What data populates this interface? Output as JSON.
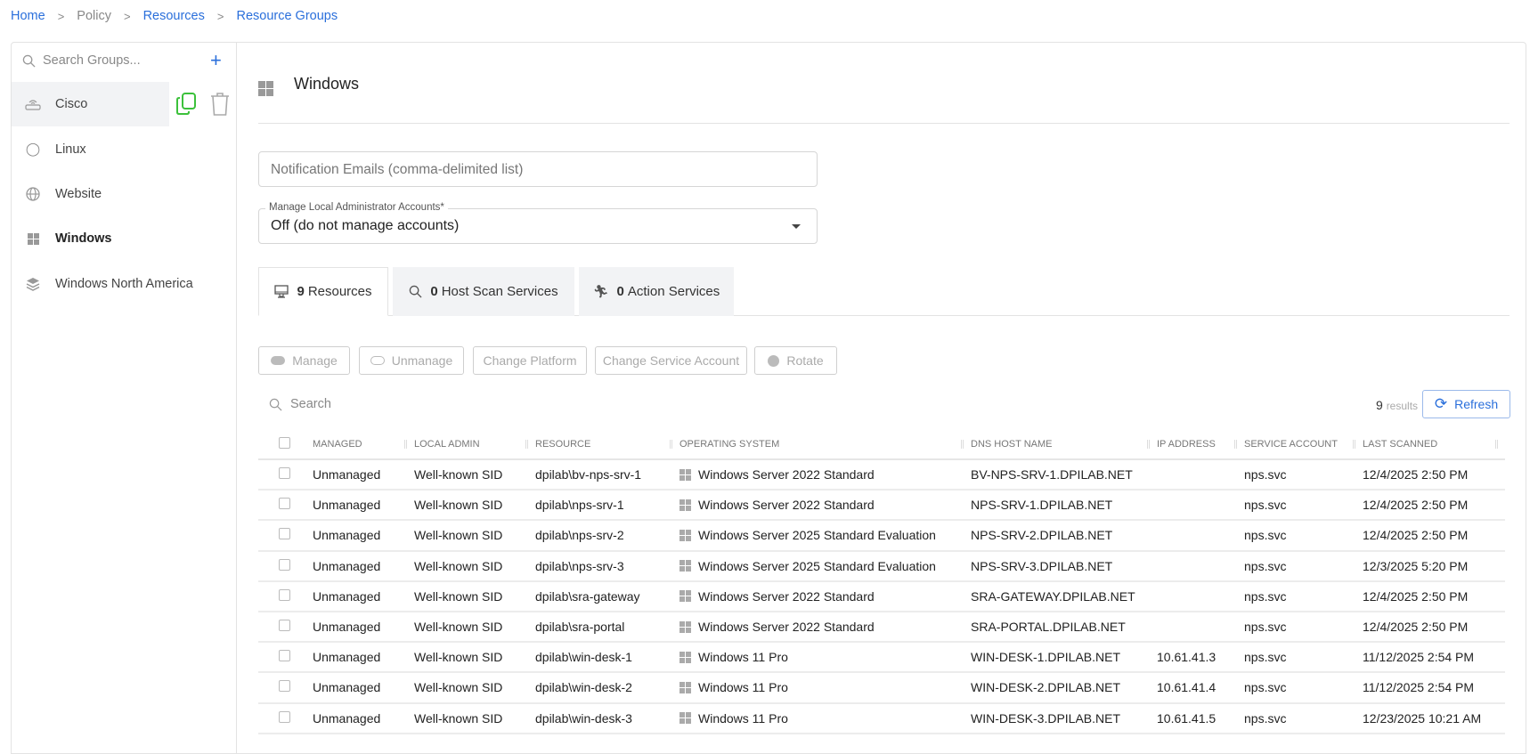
{
  "breadcrumb": [
    "Home",
    "Policy",
    "Resources",
    "Resource Groups"
  ],
  "sidebar": {
    "search_placeholder": "Search Groups...",
    "add_icon": "plus-icon",
    "items": [
      {
        "label": "Cisco",
        "icon": "router-icon",
        "selected": true
      },
      {
        "label": "Linux",
        "icon": "linux-icon"
      },
      {
        "label": "Website",
        "icon": "globe-icon"
      },
      {
        "label": "Windows",
        "icon": "windows-icon",
        "active": true
      },
      {
        "label": "Windows North America",
        "icon": "layers-icon"
      }
    ]
  },
  "main": {
    "title": "Windows",
    "notification_placeholder": "Notification Emails (comma-delimited list)",
    "manage_label": "Manage Local Administrator Accounts*",
    "manage_value": "Off (do not manage accounts)",
    "tabs": [
      {
        "count": "9",
        "label": "Resources"
      },
      {
        "count": "0",
        "label": "Host Scan Services"
      },
      {
        "count": "0",
        "label": "Action Services"
      }
    ],
    "actions": [
      "Manage",
      "Unmanage",
      "Change Platform",
      "Change Service Account",
      "Rotate"
    ],
    "search_placeholder": "Search",
    "results_count": "9",
    "results_label": "results",
    "refresh_label": "Refresh",
    "columns": [
      "Managed",
      "Local Admin",
      "Resource",
      "Operating System",
      "DNS Host Name",
      "IP Address",
      "Service Account",
      "Last Scanned"
    ],
    "rows": [
      [
        "Unmanaged",
        "Well-known SID",
        "dpilab\\bv-nps-srv-1",
        "Windows Server 2022 Standard",
        "BV-NPS-SRV-1.DPILAB.NET",
        "",
        "nps.svc",
        "12/4/2025 2:50 PM"
      ],
      [
        "Unmanaged",
        "Well-known SID",
        "dpilab\\nps-srv-1",
        "Windows Server 2022 Standard",
        "NPS-SRV-1.DPILAB.NET",
        "",
        "nps.svc",
        "12/4/2025 2:50 PM"
      ],
      [
        "Unmanaged",
        "Well-known SID",
        "dpilab\\nps-srv-2",
        "Windows Server 2025 Standard Evaluation",
        "NPS-SRV-2.DPILAB.NET",
        "",
        "nps.svc",
        "12/4/2025 2:50 PM"
      ],
      [
        "Unmanaged",
        "Well-known SID",
        "dpilab\\nps-srv-3",
        "Windows Server 2025 Standard Evaluation",
        "NPS-SRV-3.DPILAB.NET",
        "",
        "nps.svc",
        "12/3/2025 5:20 PM"
      ],
      [
        "Unmanaged",
        "Well-known SID",
        "dpilab\\sra-gateway",
        "Windows Server 2022 Standard",
        "SRA-GATEWAY.DPILAB.NET",
        "",
        "nps.svc",
        "12/4/2025 2:50 PM"
      ],
      [
        "Unmanaged",
        "Well-known SID",
        "dpilab\\sra-portal",
        "Windows Server 2022 Standard",
        "SRA-PORTAL.DPILAB.NET",
        "",
        "nps.svc",
        "12/4/2025 2:50 PM"
      ],
      [
        "Unmanaged",
        "Well-known SID",
        "dpilab\\win-desk-1",
        "Windows 11 Pro",
        "WIN-DESK-1.DPILAB.NET",
        "10.61.41.3",
        "nps.svc",
        "11/12/2025 2:54 PM"
      ],
      [
        "Unmanaged",
        "Well-known SID",
        "dpilab\\win-desk-2",
        "Windows 11 Pro",
        "WIN-DESK-2.DPILAB.NET",
        "10.61.41.4",
        "nps.svc",
        "11/12/2025 2:54 PM"
      ],
      [
        "Unmanaged",
        "Well-known SID",
        "dpilab\\win-desk-3",
        "Windows 11 Pro",
        "WIN-DESK-3.DPILAB.NET",
        "10.61.41.5",
        "nps.svc",
        "12/23/2025 10:21 AM"
      ]
    ]
  },
  "colors": {
    "accent": "#2a6fdb",
    "copy_icon": "#3cc13b"
  }
}
